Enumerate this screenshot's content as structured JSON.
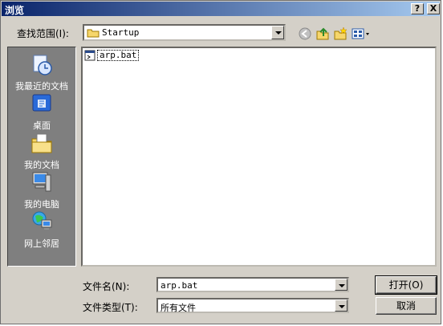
{
  "window": {
    "title": "浏览",
    "help_button": "?",
    "close_button": "X"
  },
  "lookin": {
    "label": "查找范围(I):",
    "value": "Startup"
  },
  "toolbar": {
    "back_icon": "back-icon",
    "up_icon": "up-folder-icon",
    "new_folder_icon": "new-folder-icon",
    "views_icon": "views-menu-icon"
  },
  "places": [
    {
      "label": "我最近的文档",
      "icon": "recent-documents-icon"
    },
    {
      "label": "桌面",
      "icon": "desktop-icon"
    },
    {
      "label": "我的文档",
      "icon": "my-documents-icon"
    },
    {
      "label": "我的电脑",
      "icon": "my-computer-icon"
    },
    {
      "label": "网上邻居",
      "icon": "network-places-icon"
    }
  ],
  "files": [
    {
      "name": "arp.bat",
      "icon": "batch-file-icon"
    }
  ],
  "filename": {
    "label": "文件名(N):",
    "value": "arp.bat"
  },
  "filetype": {
    "label": "文件类型(T):",
    "value": "所有文件"
  },
  "buttons": {
    "open": "打开(O)",
    "cancel": "取消"
  },
  "colors": {
    "title_start": "#0a246a",
    "title_end": "#a6caf0",
    "face": "#d4d0c8",
    "places_bg": "#7f7f7f"
  }
}
